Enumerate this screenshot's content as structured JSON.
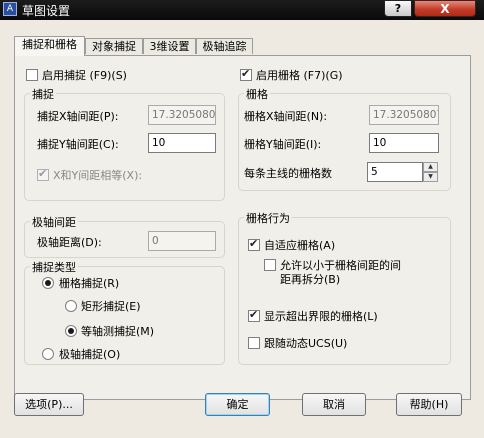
{
  "window": {
    "title": "草图设置",
    "help_glyph": "?",
    "close_glyph": "X"
  },
  "tabs": [
    "捕捉和栅格",
    "对象捕捉",
    "3维设置",
    "极轴追踪"
  ],
  "snap": {
    "enable_label": "启用捕捉 (F9)(S)",
    "enabled": false,
    "group_title": "捕捉",
    "x_label": "捕捉X轴间距(P):",
    "x_value": "17.32050807",
    "y_label": "捕捉Y轴间距(C):",
    "y_value": "10",
    "equal_label": "X和Y间距相等(X):",
    "equal_checked": true
  },
  "polar": {
    "group_title": "极轴间距",
    "distance_label": "极轴距离(D):",
    "distance_value": "0"
  },
  "snap_type": {
    "group_title": "捕捉类型",
    "grid_snap_label": "栅格捕捉(R)",
    "rect_snap_label": "矩形捕捉(E)",
    "iso_snap_label": "等轴测捕捉(M)",
    "polar_snap_label": "极轴捕捉(O)"
  },
  "grid": {
    "enable_label": "启用栅格 (F7)(G)",
    "enabled": true,
    "group_title": "栅格",
    "x_label": "栅格X轴间距(N):",
    "x_value": "17.32050807",
    "y_label": "栅格Y轴间距(I):",
    "y_value": "10",
    "major_label": "每条主线的栅格数",
    "major_value": "5"
  },
  "grid_behavior": {
    "group_title": "栅格行为",
    "adaptive_label": "自适应栅格(A)",
    "adaptive_checked": true,
    "subdivide_label_line1": "允许以小于栅格间距的间",
    "subdivide_label_line2": "距再拆分(B)",
    "subdivide_checked": false,
    "beyond_limits_label": "显示超出界限的栅格(L)",
    "beyond_limits_checked": true,
    "follow_ucs_label": "跟随动态UCS(U)",
    "follow_ucs_checked": false
  },
  "buttons": {
    "options": "选项(P)...",
    "ok": "确定",
    "cancel": "取消",
    "help": "帮助(H)"
  }
}
